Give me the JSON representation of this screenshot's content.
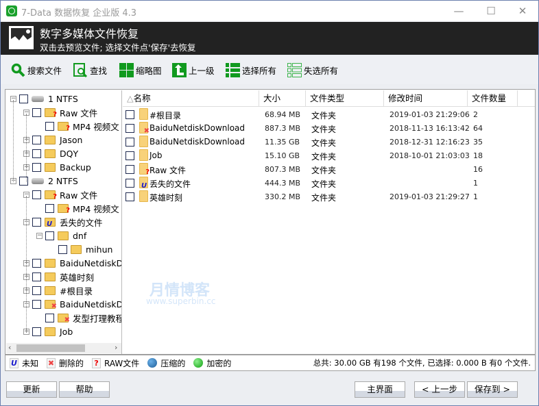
{
  "window": {
    "title": "7-Data 数据恢复 企业版 4.3",
    "minimize": "—",
    "maximize": "☐",
    "close": "✕"
  },
  "header": {
    "title": "数字多媒体文件恢复",
    "subtitle": "双击去预览文件; 选择文件点'保存'去恢复"
  },
  "toolbar": [
    {
      "label": "搜索文件",
      "icon": "search-icon"
    },
    {
      "label": "查找",
      "icon": "find-icon"
    },
    {
      "label": "缩略图",
      "icon": "thumbnail-icon"
    },
    {
      "label": "上一级",
      "icon": "up-level-icon"
    },
    {
      "label": "选择所有",
      "icon": "select-all-icon"
    },
    {
      "label": "失选所有",
      "icon": "deselect-all-icon"
    }
  ],
  "tree": [
    {
      "label": "1 NTFS",
      "level": 0,
      "icon": "drive",
      "exp": "−"
    },
    {
      "label": "Raw 文件",
      "level": 1,
      "icon": "raw",
      "exp": "−"
    },
    {
      "label": "MP4 视频文",
      "level": 2,
      "icon": "raw",
      "exp": ""
    },
    {
      "label": "Jason",
      "level": 1,
      "icon": "folder",
      "exp": "+"
    },
    {
      "label": "DQY",
      "level": 1,
      "icon": "folder",
      "exp": "+"
    },
    {
      "label": "Backup",
      "level": 1,
      "icon": "folder",
      "exp": "+"
    },
    {
      "label": "2 NTFS",
      "level": 0,
      "icon": "drive",
      "exp": "−"
    },
    {
      "label": "Raw 文件",
      "level": 1,
      "icon": "raw",
      "exp": "−"
    },
    {
      "label": "MP4 视频文",
      "level": 2,
      "icon": "raw",
      "exp": ""
    },
    {
      "label": "丢失的文件",
      "level": 1,
      "icon": "unknown",
      "exp": "−"
    },
    {
      "label": "dnf",
      "level": 2,
      "icon": "folder",
      "exp": "−"
    },
    {
      "label": "mihun",
      "level": 3,
      "icon": "folder",
      "exp": ""
    },
    {
      "label": "BaiduNetdiskD",
      "level": 1,
      "icon": "folder",
      "exp": "+"
    },
    {
      "label": "英雄时刻",
      "level": 1,
      "icon": "folder",
      "exp": "+"
    },
    {
      "label": "#根目录",
      "level": 1,
      "icon": "folder",
      "exp": "+"
    },
    {
      "label": "BaiduNetdiskD",
      "level": 1,
      "icon": "deleted",
      "exp": "−"
    },
    {
      "label": "发型打理教程",
      "level": 2,
      "icon": "deleted",
      "exp": ""
    },
    {
      "label": "Job",
      "level": 1,
      "icon": "folder",
      "exp": "+"
    }
  ],
  "list": {
    "columns": [
      "名称",
      "大小",
      "文件类型",
      "修改时间",
      "文件数量"
    ],
    "sort_indicator": "△",
    "rows": [
      {
        "name": "#根目录",
        "size": "68.94 MB",
        "type": "文件夹",
        "modified": "2019-01-03 21:29:06",
        "count": "2",
        "icon": "folder"
      },
      {
        "name": "BaiduNetdiskDownload",
        "size": "887.3 MB",
        "type": "文件夹",
        "modified": "2018-11-13 16:13:42",
        "count": "64",
        "icon": "deleted"
      },
      {
        "name": "BaiduNetdiskDownload",
        "size": "11.35 GB",
        "type": "文件夹",
        "modified": "2018-12-31 12:16:23",
        "count": "35",
        "icon": "folder"
      },
      {
        "name": "Job",
        "size": "15.10 GB",
        "type": "文件夹",
        "modified": "2018-10-01 21:03:03",
        "count": "18",
        "icon": "folder"
      },
      {
        "name": "Raw 文件",
        "size": "807.3 MB",
        "type": "文件夹",
        "modified": "",
        "count": "16",
        "icon": "raw"
      },
      {
        "name": "丢失的文件",
        "size": "444.3 MB",
        "type": "文件夹",
        "modified": "",
        "count": "1",
        "icon": "unknown"
      },
      {
        "name": "英雄时刻",
        "size": "330.2 MB",
        "type": "文件夹",
        "modified": "2019-01-03 21:29:27",
        "count": "1",
        "icon": "folder"
      }
    ]
  },
  "legend": [
    {
      "label": "未知",
      "glyph": "U",
      "color": "#1a1acc"
    },
    {
      "label": "删除的",
      "glyph": "✖",
      "color": "#e44"
    },
    {
      "label": "RAW文件",
      "glyph": "?",
      "color": "#e00"
    },
    {
      "label": "压缩的",
      "color": "#1f5f99"
    },
    {
      "label": "加密的",
      "color": "#1db31d"
    }
  ],
  "summary": "总共: 30.00 GB 有198 个文件, 已选择: 0.000 B 有0 个文件.",
  "watermark": {
    "title": "月情博客",
    "url": "www.superbin.cc"
  },
  "buttons": {
    "refresh": "更新",
    "help": "帮助",
    "home": "主界面",
    "back": "< 上一步",
    "save": "保存到 >"
  },
  "colors": {
    "accent": "#1aa12c",
    "header_bg": "#222222"
  }
}
